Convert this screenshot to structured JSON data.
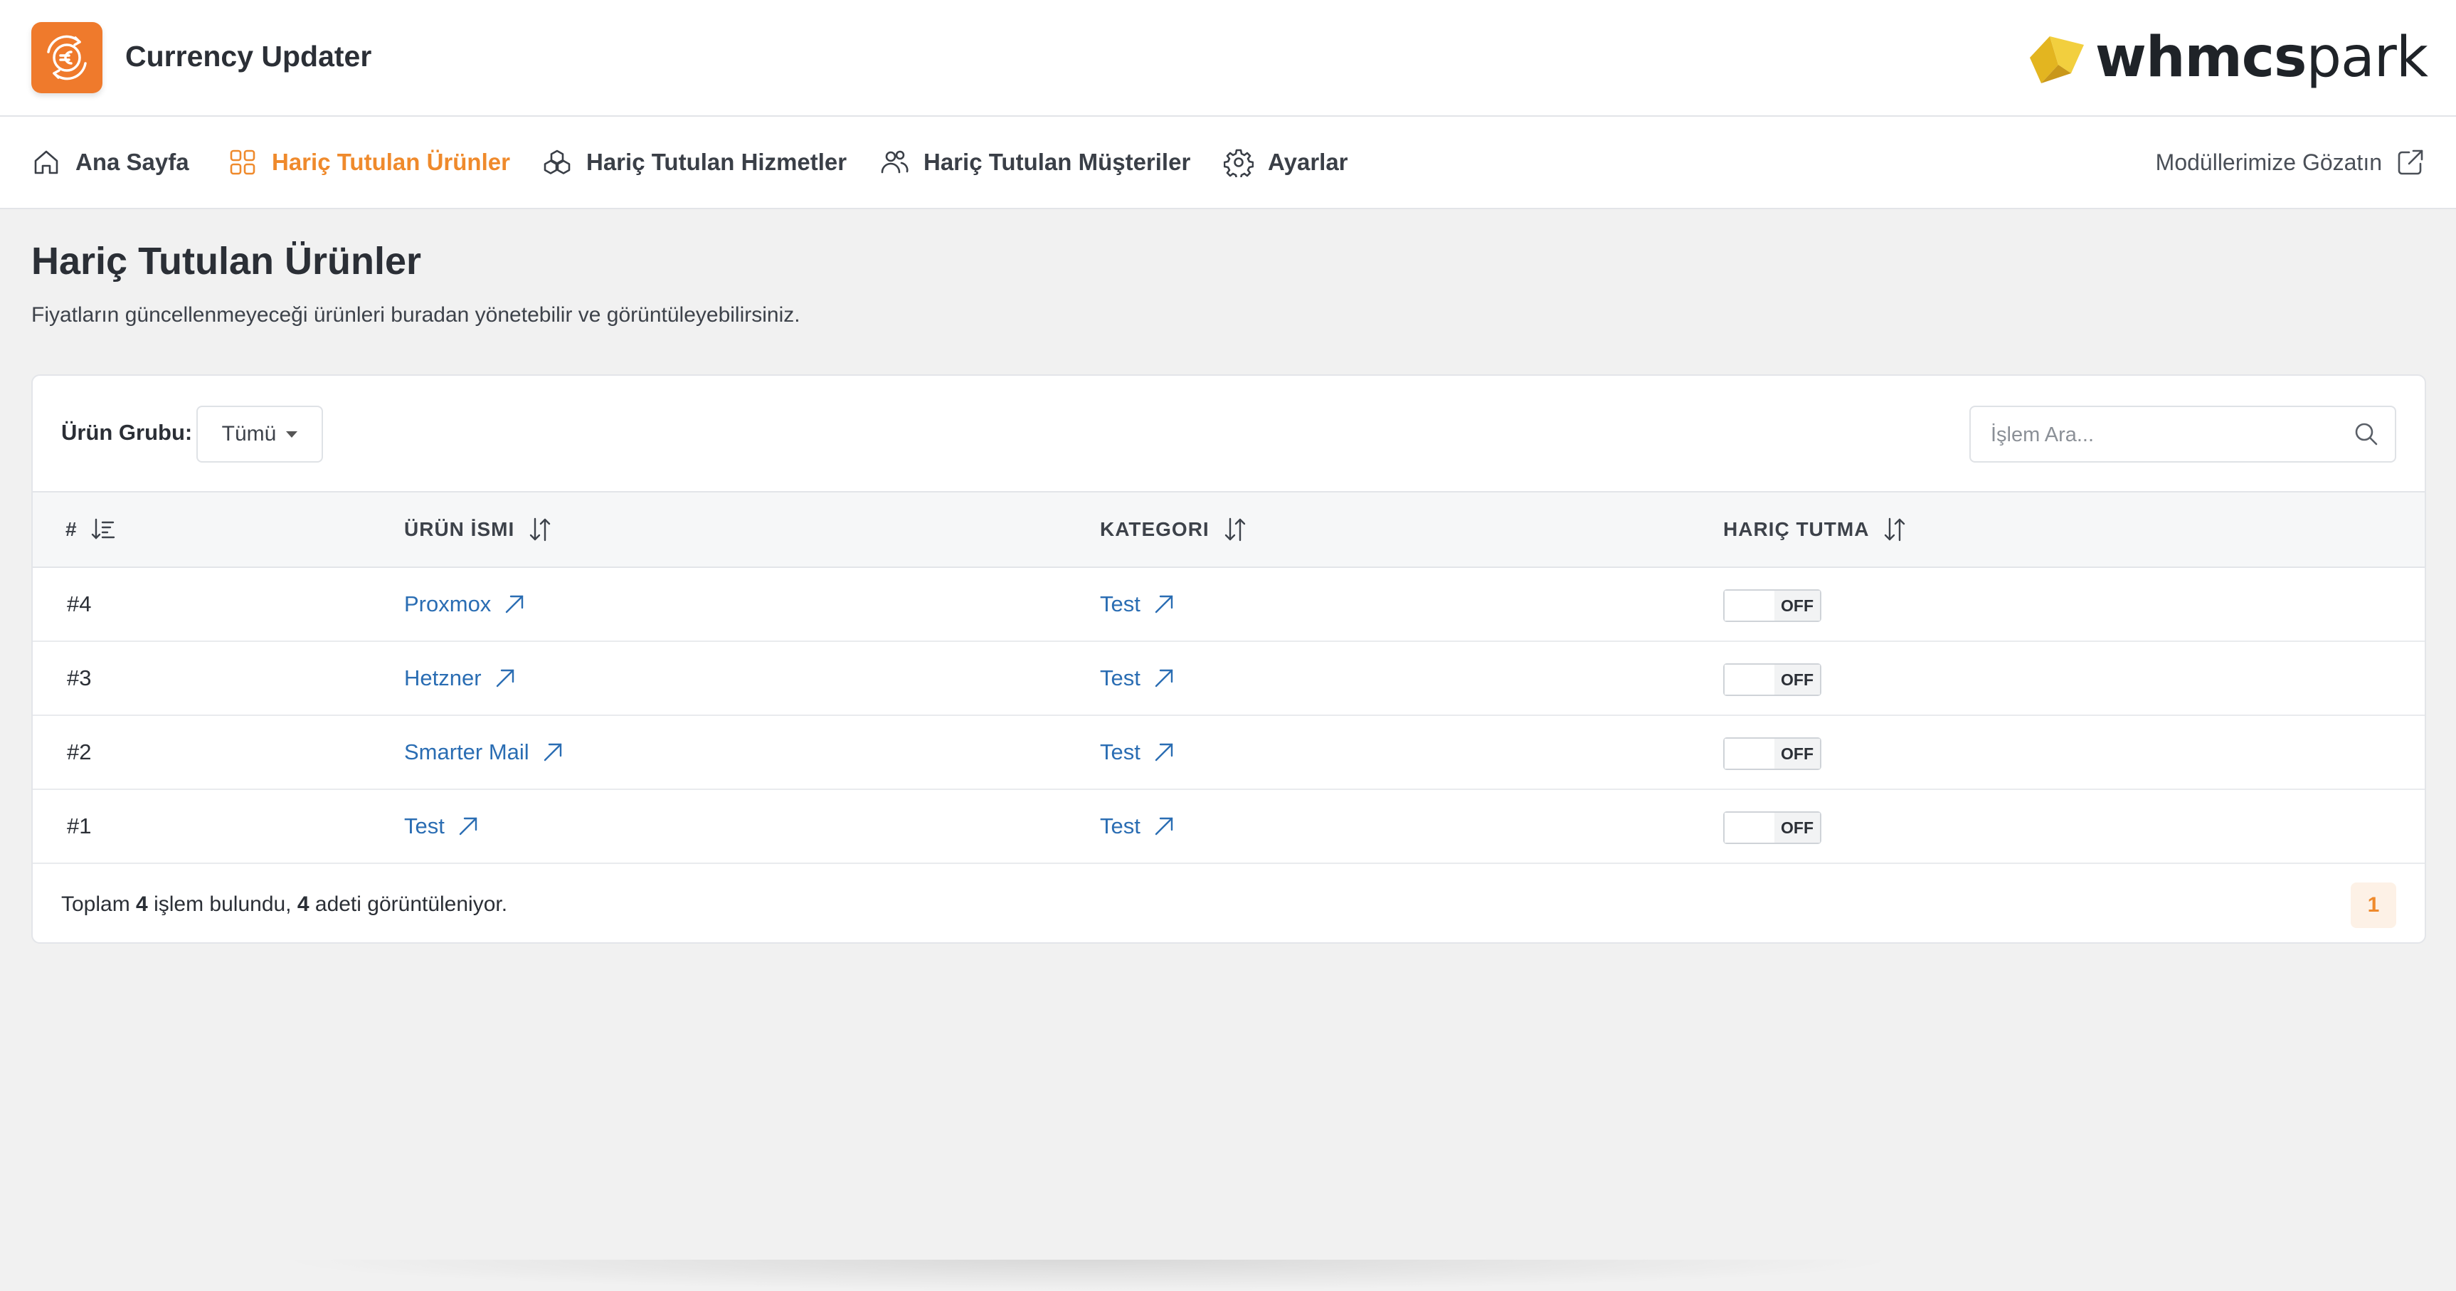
{
  "app": {
    "title": "Currency Updater",
    "brand_bold": "whmcs",
    "brand_light": "park"
  },
  "nav": {
    "items": [
      {
        "label": "Ana Sayfa",
        "icon": "home-icon"
      },
      {
        "label": "Hariç Tutulan Ürünler",
        "icon": "grid-icon",
        "active": true
      },
      {
        "label": "Hariç Tutulan Hizmetler",
        "icon": "services-icon"
      },
      {
        "label": "Hariç Tutulan Müşteriler",
        "icon": "users-icon"
      },
      {
        "label": "Ayarlar",
        "icon": "gear-icon"
      }
    ],
    "external_label": "Modüllerimize Gözatın"
  },
  "page": {
    "title": "Hariç Tutulan Ürünler",
    "subtitle": "Fiyatların güncellenmeyeceği ürünleri buradan yönetebilir ve görüntüleyebilirsiniz."
  },
  "filter": {
    "label": "Ürün Grubu:",
    "selected": "Tümü"
  },
  "search": {
    "placeholder": "İşlem Ara..."
  },
  "table": {
    "headers": [
      "#",
      "ÜRÜN İSMI",
      "KATEGORI",
      "HARIÇ TUTMA"
    ],
    "rows": [
      {
        "id": "#4",
        "name": "Proxmox",
        "category": "Test",
        "toggle": "OFF"
      },
      {
        "id": "#3",
        "name": "Hetzner",
        "category": "Test",
        "toggle": "OFF"
      },
      {
        "id": "#2",
        "name": "Smarter Mail",
        "category": "Test",
        "toggle": "OFF"
      },
      {
        "id": "#1",
        "name": "Test",
        "category": "Test",
        "toggle": "OFF"
      }
    ]
  },
  "footer": {
    "prefix": "Toplam ",
    "total": "4",
    "middle": " işlem bulundu, ",
    "shown": "4",
    "suffix": " adeti görüntüleniyor.",
    "current_page": "1"
  },
  "colors": {
    "accent": "#ef8a2c",
    "link": "#2a6db3",
    "logo_bg": "#ef7a2c",
    "brand_gold": "#e3b520"
  }
}
